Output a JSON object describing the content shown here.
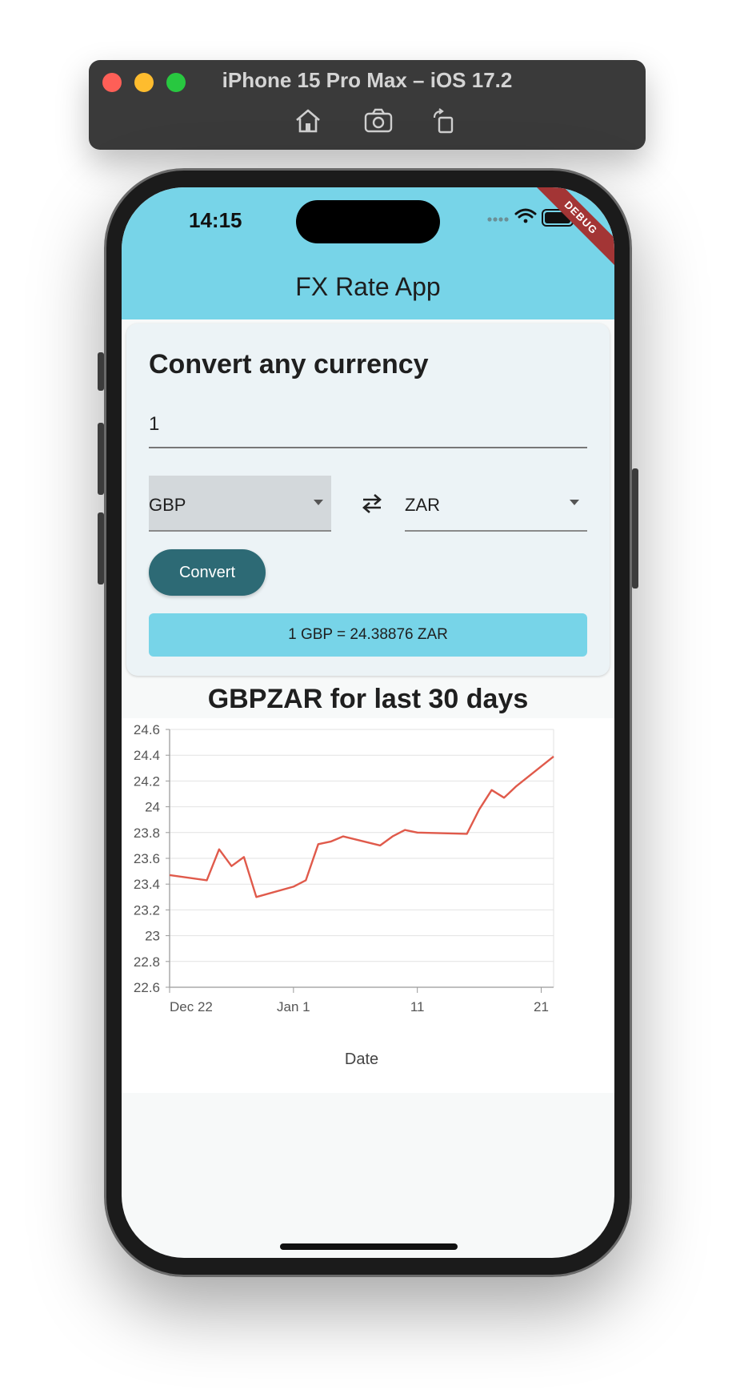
{
  "simulator": {
    "title": "iPhone 15 Pro Max – iOS 17.2",
    "tools": [
      "home-icon",
      "screenshot-icon",
      "rotate-icon"
    ]
  },
  "status_bar": {
    "time": "14:15",
    "debug_label": "DEBUG"
  },
  "app": {
    "title": "FX Rate App",
    "card_title": "Convert any currency",
    "amount_value": "1",
    "from_currency": "GBP",
    "to_currency": "ZAR",
    "convert_label": "Convert",
    "result_text": "1 GBP = 24.38876 ZAR"
  },
  "colors": {
    "accent": "#77d4e8",
    "button": "#2d6a75",
    "line": "#e05a4b"
  },
  "chart_data": {
    "type": "line",
    "title": "GBPZAR for last 30 days",
    "xlabel": "Date",
    "ylabel": "",
    "ylim": [
      22.6,
      24.6
    ],
    "yticks": [
      "22.6",
      "22.8",
      "23",
      "23.2",
      "23.4",
      "23.6",
      "23.8",
      "24",
      "24.2",
      "24.4",
      "24.6"
    ],
    "xticks": [
      {
        "label": "Dec 22",
        "date": "2023-12-22"
      },
      {
        "label": "Jan 1",
        "date": "2024-01-01"
      },
      {
        "label": "11",
        "date": "2024-01-11"
      },
      {
        "label": "21",
        "date": "2024-01-21"
      }
    ],
    "xlim": [
      "2023-12-22",
      "2024-01-22"
    ],
    "grid": true,
    "series": [
      {
        "points": [
          {
            "x": "2023-12-22",
            "y": 23.47
          },
          {
            "x": "2023-12-25",
            "y": 23.43
          },
          {
            "x": "2023-12-26",
            "y": 23.67
          },
          {
            "x": "2023-12-27",
            "y": 23.54
          },
          {
            "x": "2023-12-28",
            "y": 23.61
          },
          {
            "x": "2023-12-29",
            "y": 23.3
          },
          {
            "x": "2024-01-01",
            "y": 23.38
          },
          {
            "x": "2024-01-02",
            "y": 23.43
          },
          {
            "x": "2024-01-03",
            "y": 23.71
          },
          {
            "x": "2024-01-04",
            "y": 23.73
          },
          {
            "x": "2024-01-05",
            "y": 23.77
          },
          {
            "x": "2024-01-08",
            "y": 23.7
          },
          {
            "x": "2024-01-09",
            "y": 23.77
          },
          {
            "x": "2024-01-10",
            "y": 23.82
          },
          {
            "x": "2024-01-11",
            "y": 23.8
          },
          {
            "x": "2024-01-15",
            "y": 23.79
          },
          {
            "x": "2024-01-16",
            "y": 23.98
          },
          {
            "x": "2024-01-17",
            "y": 24.13
          },
          {
            "x": "2024-01-18",
            "y": 24.07
          },
          {
            "x": "2024-01-19",
            "y": 24.16
          },
          {
            "x": "2024-01-22",
            "y": 24.39
          }
        ]
      }
    ]
  }
}
